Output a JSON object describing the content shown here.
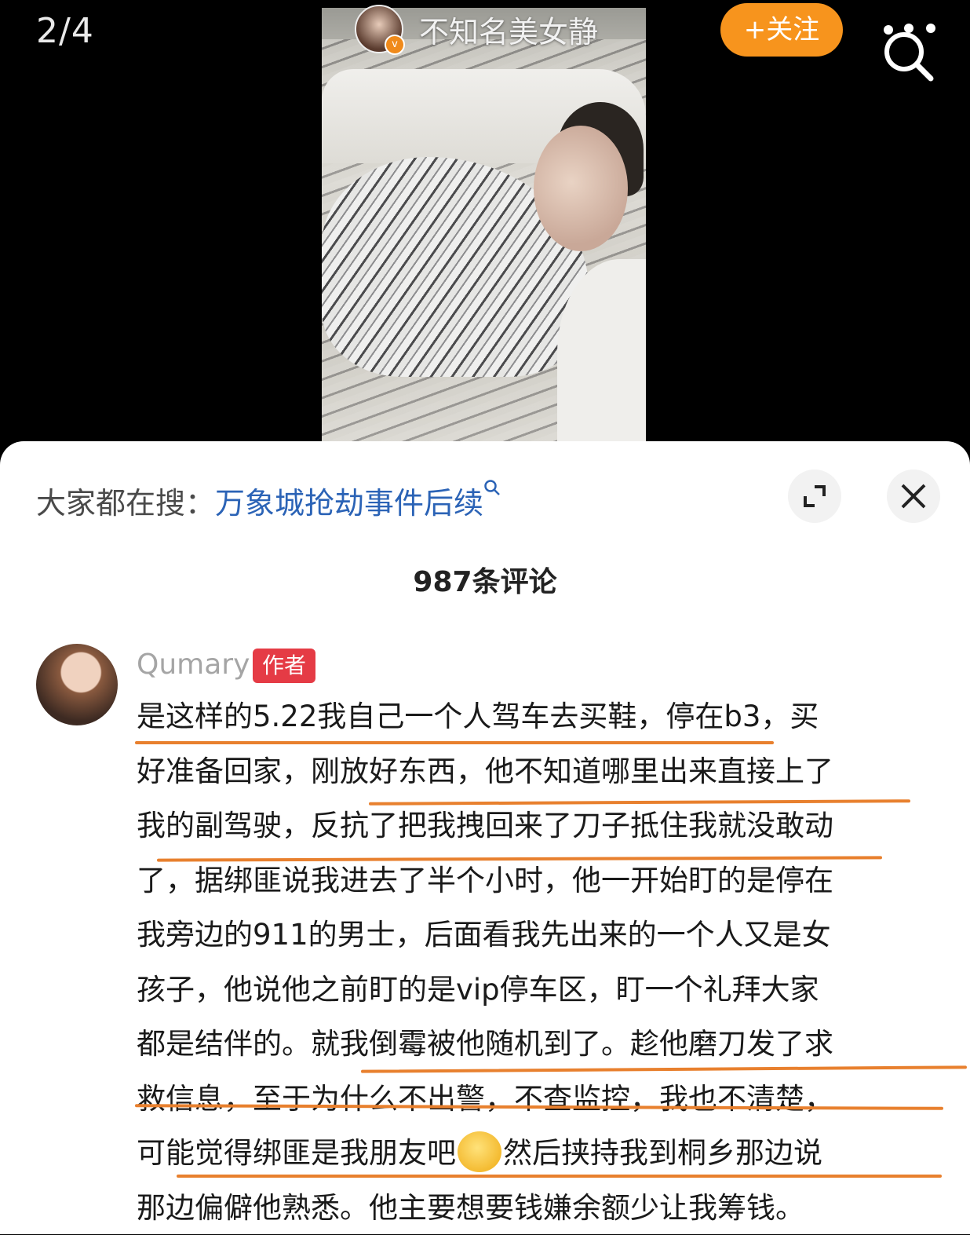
{
  "viewer": {
    "page_indicator": "2/4",
    "author_name": "不知名美女静",
    "verified_mark": "v",
    "follow_label": "+关注"
  },
  "sheet": {
    "hot_search_prefix": "大家都在搜：",
    "hot_search_query": "万象城抢劫事件后续",
    "comment_count": "987条评论"
  },
  "comment": {
    "username": "Qumary",
    "badge": "作者",
    "lines": [
      "是这样的5.22我自己一个人驾车去买鞋，停在b3，买",
      "好准备回家，刚放好东西，他不知道哪里出来直接上了",
      "我的副驾驶，反抗了把我拽回来了刀子抵住我就没敢动",
      "了，据绑匪说我进去了半个小时，他一开始盯的是停在",
      "我旁边的911的男士，后面看我先出来的一个人又是女",
      "孩子，他说他之前盯的是vip停车区，盯一个礼拜大家",
      "都是结伴的。就我倒霉被他随机到了。趁他磨刀发了求",
      "救信息，至于为什么不出警，不查监控，我也不清楚，",
      "可能觉得绑匪是我朋友吧",
      "然后挟持我到桐乡那边说",
      "那边偏僻他熟悉。他主要想要钱嫌余额少让我筹钱。"
    ]
  },
  "colors": {
    "follow_button": "#f7941d",
    "author_badge": "#e53b45",
    "hot_search_link": "#2b63b6",
    "annotation_underline": "#e8802e"
  },
  "icons": [
    "search-icon",
    "expand-icon",
    "close-icon",
    "verified-icon",
    "emoji-icon"
  ]
}
